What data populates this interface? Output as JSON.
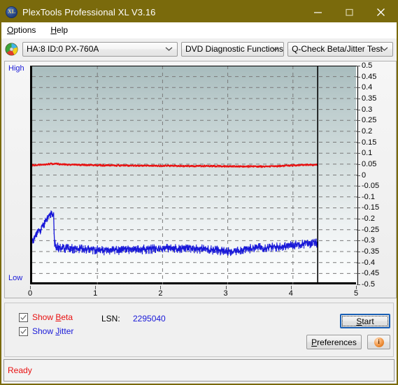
{
  "window": {
    "title": "PlexTools Professional XL V3.16",
    "app_icon": "xl-disc-icon",
    "minimize_label": "—",
    "maximize_label": "□",
    "close_label": "×"
  },
  "menubar": {
    "items": [
      {
        "label": "Options",
        "accel": "O"
      },
      {
        "label": "Help",
        "accel": "H"
      }
    ]
  },
  "toolbar": {
    "drive_icon": "cd-disc-icon",
    "drive": {
      "value": "HA:8 ID:0  PX-760A"
    },
    "function": {
      "value": "DVD Diagnostic Functions"
    },
    "test": {
      "value": "Q-Check Beta/Jitter Test"
    }
  },
  "chart_panel": {
    "high_label": "High",
    "low_label": "Low"
  },
  "controls": {
    "show_beta": {
      "label": "Show Beta",
      "accel": "B",
      "checked": true
    },
    "show_jitter": {
      "label": "Show Jitter",
      "accel": "J",
      "checked": true
    },
    "lsn_label": "LSN:",
    "lsn_value": "2295040",
    "start_label": "Start",
    "start_accel": "S",
    "preferences_label": "Preferences",
    "preferences_accel": "P",
    "info_label": "i"
  },
  "statusbar": {
    "text": "Ready"
  },
  "colors": {
    "titlebar": "#7a6a0c",
    "beta": "#e81010",
    "jitter": "#1818d8",
    "axis_text": "#000000",
    "label_blue": "#1818d8",
    "status_text": "#e81010"
  },
  "chart_data": {
    "type": "line",
    "title": "Q-Check Beta/Jitter Test",
    "xlabel": "",
    "ylabel": "",
    "xlim": [
      0,
      5
    ],
    "ylim": [
      -0.5,
      0.5
    ],
    "xticks": [
      0,
      1,
      2,
      3,
      4,
      5
    ],
    "yticks": [
      0.5,
      0.45,
      0.4,
      0.35,
      0.3,
      0.25,
      0.2,
      0.15,
      0.1,
      0.05,
      0,
      -0.05,
      -0.1,
      -0.15,
      -0.2,
      -0.25,
      -0.3,
      -0.35,
      -0.4,
      -0.45,
      -0.5
    ],
    "grid": true,
    "grid_style": "dashed",
    "y_axis_side": "right",
    "left_axis_labels": [
      "High",
      "Low"
    ],
    "data_end_marker_x": 4.38,
    "series": [
      {
        "name": "Beta",
        "color": "#e81010",
        "x": [
          0.0,
          0.05,
          0.1,
          0.15,
          0.2,
          0.25,
          0.3,
          0.35,
          0.4,
          0.45,
          0.5,
          0.6,
          0.7,
          0.8,
          0.9,
          1.0,
          1.1,
          1.2,
          1.3,
          1.4,
          1.5,
          1.6,
          1.7,
          1.8,
          1.9,
          2.0,
          2.1,
          2.2,
          2.3,
          2.4,
          2.5,
          2.6,
          2.7,
          2.8,
          2.9,
          3.0,
          3.1,
          3.2,
          3.3,
          3.4,
          3.5,
          3.6,
          3.7,
          3.8,
          3.9,
          4.0,
          4.1,
          4.2,
          4.3,
          4.38
        ],
        "y": [
          0.046,
          0.047,
          0.048,
          0.049,
          0.05,
          0.052,
          0.053,
          0.053,
          0.052,
          0.051,
          0.05,
          0.049,
          0.048,
          0.048,
          0.047,
          0.047,
          0.046,
          0.046,
          0.046,
          0.045,
          0.045,
          0.045,
          0.045,
          0.044,
          0.044,
          0.044,
          0.044,
          0.044,
          0.043,
          0.043,
          0.043,
          0.043,
          0.043,
          0.043,
          0.042,
          0.042,
          0.042,
          0.041,
          0.041,
          0.041,
          0.041,
          0.041,
          0.042,
          0.043,
          0.045,
          0.046,
          0.047,
          0.048,
          0.048,
          0.048
        ],
        "noise": 0.004
      },
      {
        "name": "Jitter",
        "color": "#1818d8",
        "x": [
          0.0,
          0.03,
          0.06,
          0.09,
          0.12,
          0.15,
          0.18,
          0.21,
          0.24,
          0.27,
          0.3,
          0.32,
          0.33,
          0.34,
          0.36,
          0.4,
          0.5,
          0.6,
          0.7,
          0.8,
          0.9,
          1.0,
          1.1,
          1.2,
          1.3,
          1.4,
          1.5,
          1.6,
          1.7,
          1.8,
          1.9,
          2.0,
          2.1,
          2.2,
          2.3,
          2.4,
          2.5,
          2.6,
          2.7,
          2.8,
          2.9,
          3.0,
          3.05,
          3.1,
          3.2,
          3.3,
          3.4,
          3.5,
          3.6,
          3.7,
          3.8,
          3.9,
          4.0,
          4.1,
          4.2,
          4.3,
          4.38
        ],
        "y": [
          -0.3,
          -0.285,
          -0.27,
          -0.262,
          -0.25,
          -0.235,
          -0.22,
          -0.205,
          -0.195,
          -0.185,
          -0.178,
          -0.176,
          -0.18,
          -0.3,
          -0.325,
          -0.33,
          -0.333,
          -0.335,
          -0.336,
          -0.337,
          -0.338,
          -0.34,
          -0.343,
          -0.345,
          -0.343,
          -0.341,
          -0.34,
          -0.339,
          -0.338,
          -0.337,
          -0.336,
          -0.335,
          -0.334,
          -0.334,
          -0.333,
          -0.333,
          -0.334,
          -0.336,
          -0.338,
          -0.341,
          -0.344,
          -0.348,
          -0.355,
          -0.346,
          -0.34,
          -0.336,
          -0.332,
          -0.33,
          -0.329,
          -0.328,
          -0.326,
          -0.323,
          -0.318,
          -0.314,
          -0.312,
          -0.31,
          -0.31
        ],
        "noise": 0.02
      }
    ]
  }
}
